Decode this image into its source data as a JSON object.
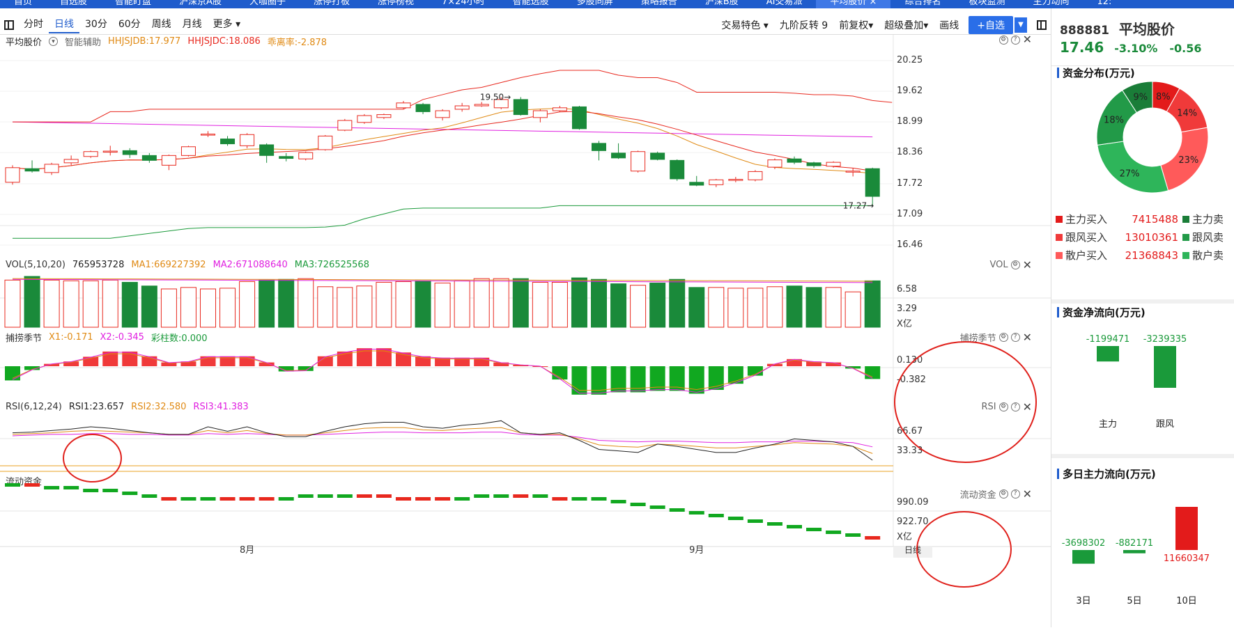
{
  "top_tabs": [
    "首页",
    "自选股",
    "智能盯盘",
    "沪深京A股",
    "大咖圈子",
    "涨停打板",
    "涨停榜视",
    "7×24小时",
    "智能选股",
    "多股同屏",
    "策略报告",
    "沪深B股",
    "AI交易派",
    "平均股价 ×",
    "综合排名",
    "板块监测",
    "主力动向",
    "12:"
  ],
  "toolbar": {
    "periods": [
      "分时",
      "日线",
      "30分",
      "60分",
      "周线",
      "月线",
      "更多 ▾"
    ],
    "active": "日线",
    "right_items": [
      "交易特色 ▾",
      "九阶反转 9",
      "前复权▾",
      "超级叠加▾",
      "画线"
    ],
    "add_btn": "+自选",
    "drop": "▼"
  },
  "main": {
    "name": "平均股价",
    "assist": "智能辅助",
    "hhjsjdb": "HHJSJDB:17.977",
    "hhjsjdc": "HHJSJDC:18.086",
    "bias": "乖离率:-2.878",
    "y_labels": [
      "20.25",
      "19.62",
      "18.99",
      "18.36",
      "17.72",
      "17.09",
      "16.46"
    ],
    "high_label": "19.50→",
    "low_label": "17.27→"
  },
  "vol": {
    "label": "VOL(5,10,20)",
    "value": "765953728",
    "ma1": "MA1:669227392",
    "ma2": "MA2:671088640",
    "ma3": "MA3:726525568",
    "tag": "VOL",
    "y_labels": [
      "6.58",
      "3.29",
      "X亿"
    ]
  },
  "season": {
    "label": "捕捞季节",
    "x1": "X1:-0.171",
    "x2": "X2:-0.345",
    "bar": "彩柱数:0.000",
    "tag": "捕捞季节",
    "y_labels": [
      "0.130",
      "-0.382"
    ]
  },
  "rsi": {
    "label": "RSI(6,12,24)",
    "rsi1": "RSI1:23.657",
    "rsi2": "RSI2:32.580",
    "rsi3": "RSI3:41.383",
    "tag": "RSI",
    "y_labels": [
      "66.67",
      "33.33"
    ]
  },
  "liquid": {
    "label": "流动资金",
    "tag": "流动资金",
    "y_labels": [
      "990.09",
      "922.70",
      "X亿"
    ]
  },
  "xaxis": {
    "labels": [
      "8月",
      "9月"
    ],
    "right": "日线"
  },
  "colors": {
    "up": "#e8281e",
    "down": "#1a8a3a",
    "accent": "#1f5ccc"
  },
  "right_panel": {
    "code": "888881",
    "name": "平均股价",
    "price": "17.46",
    "pct": "-3.10%",
    "chg": "-0.56",
    "dist_title": "资金分布(万元)",
    "donut": [
      {
        "pct": "8%",
        "color": "#e31b1b",
        "value": 8
      },
      {
        "pct": "14%",
        "color": "#f03a3a",
        "value": 14
      },
      {
        "pct": "23%",
        "color": "#ff5a5a",
        "value": 23
      },
      {
        "pct": "27%",
        "color": "#2eb55a",
        "value": 27
      },
      {
        "pct": "18%",
        "color": "#229a48",
        "value": 18
      },
      {
        "pct": "9%",
        "color": "#1a7d38",
        "value": 9
      }
    ],
    "flows": [
      {
        "name": "主力买入",
        "value": "7415488",
        "sell": "主力卖",
        "c1": "#e31b1b",
        "c2": "#1a7d38"
      },
      {
        "name": "跟风买入",
        "value": "13010361",
        "sell": "跟风卖",
        "c1": "#f03a3a",
        "c2": "#229a48"
      },
      {
        "name": "散户买入",
        "value": "21368843",
        "sell": "散户卖",
        "c1": "#ff5a5a",
        "c2": "#2eb55a"
      }
    ],
    "net_title": "资金净流向(万元)",
    "net": [
      {
        "label": "主力",
        "value": "-1199471",
        "amount": -1199471
      },
      {
        "label": "跟风",
        "value": "-3239335",
        "amount": -3239335
      }
    ],
    "multi_title": "多日主力流向(万元)",
    "multi": [
      {
        "label": "3日",
        "value": "-3698302",
        "amount": -3698302
      },
      {
        "label": "5日",
        "value": "-882171",
        "amount": -882171
      },
      {
        "label": "10日",
        "value": "11660347",
        "amount": 11660347
      }
    ]
  },
  "chart_data": {
    "type": "candlestick",
    "candles": [
      {
        "o": 17.75,
        "c": 18.05,
        "h": 18.1,
        "l": 17.7
      },
      {
        "o": 18.03,
        "c": 17.98,
        "h": 18.2,
        "l": 17.95
      },
      {
        "o": 17.95,
        "c": 18.12,
        "h": 18.15,
        "l": 17.9
      },
      {
        "o": 18.15,
        "c": 18.22,
        "h": 18.3,
        "l": 18.1
      },
      {
        "o": 18.28,
        "c": 18.38,
        "h": 18.4,
        "l": 18.25
      },
      {
        "o": 18.38,
        "c": 18.39,
        "h": 18.5,
        "l": 18.3
      },
      {
        "o": 18.4,
        "c": 18.32,
        "h": 18.45,
        "l": 18.25
      },
      {
        "o": 18.3,
        "c": 18.2,
        "h": 18.35,
        "l": 18.15
      },
      {
        "o": 18.1,
        "c": 18.3,
        "h": 18.32,
        "l": 18.0
      },
      {
        "o": 18.3,
        "c": 18.48,
        "h": 18.5,
        "l": 18.28
      },
      {
        "o": 18.72,
        "c": 18.74,
        "h": 18.8,
        "l": 18.68
      },
      {
        "o": 18.64,
        "c": 18.54,
        "h": 18.7,
        "l": 18.5
      },
      {
        "o": 18.5,
        "c": 18.73,
        "h": 18.76,
        "l": 18.45
      },
      {
        "o": 18.52,
        "c": 18.3,
        "h": 18.55,
        "l": 18.15
      },
      {
        "o": 18.28,
        "c": 18.24,
        "h": 18.35,
        "l": 18.18
      },
      {
        "o": 18.23,
        "c": 18.36,
        "h": 18.38,
        "l": 18.2
      },
      {
        "o": 18.42,
        "c": 18.7,
        "h": 18.72,
        "l": 18.4
      },
      {
        "o": 18.82,
        "c": 19.02,
        "h": 19.05,
        "l": 18.8
      },
      {
        "o": 18.98,
        "c": 19.12,
        "h": 19.15,
        "l": 18.95
      },
      {
        "o": 19.08,
        "c": 19.14,
        "h": 19.16,
        "l": 19.05
      },
      {
        "o": 19.28,
        "c": 19.38,
        "h": 19.42,
        "l": 19.25
      },
      {
        "o": 19.35,
        "c": 19.2,
        "h": 19.38,
        "l": 19.15
      },
      {
        "o": 19.08,
        "c": 19.22,
        "h": 19.25,
        "l": 19.02
      },
      {
        "o": 19.25,
        "c": 19.32,
        "h": 19.38,
        "l": 19.2
      },
      {
        "o": 19.32,
        "c": 19.35,
        "h": 19.4,
        "l": 19.3
      },
      {
        "o": 19.28,
        "c": 19.45,
        "h": 19.5,
        "l": 19.25
      },
      {
        "o": 19.45,
        "c": 19.14,
        "h": 19.5,
        "l": 19.12
      },
      {
        "o": 19.08,
        "c": 19.22,
        "h": 19.25,
        "l": 18.98
      },
      {
        "o": 19.22,
        "c": 19.28,
        "h": 19.32,
        "l": 19.2
      },
      {
        "o": 19.3,
        "c": 18.85,
        "h": 19.32,
        "l": 18.83
      },
      {
        "o": 18.55,
        "c": 18.4,
        "h": 18.6,
        "l": 18.2
      },
      {
        "o": 18.35,
        "c": 18.25,
        "h": 18.55,
        "l": 18.23
      },
      {
        "o": 17.98,
        "c": 18.38,
        "h": 18.4,
        "l": 17.95
      },
      {
        "o": 18.35,
        "c": 18.22,
        "h": 18.38,
        "l": 18.2
      },
      {
        "o": 18.2,
        "c": 17.82,
        "h": 18.22,
        "l": 17.78
      },
      {
        "o": 17.75,
        "c": 17.69,
        "h": 17.88,
        "l": 17.67
      },
      {
        "o": 17.7,
        "c": 17.8,
        "h": 17.82,
        "l": 17.65
      },
      {
        "o": 17.8,
        "c": 17.81,
        "h": 17.86,
        "l": 17.75
      },
      {
        "o": 17.8,
        "c": 17.97,
        "h": 18.0,
        "l": 17.77
      },
      {
        "o": 18.06,
        "c": 18.21,
        "h": 18.24,
        "l": 18.02
      },
      {
        "o": 18.23,
        "c": 18.16,
        "h": 18.28,
        "l": 18.12
      },
      {
        "o": 18.15,
        "c": 18.09,
        "h": 18.17,
        "l": 18.05
      },
      {
        "o": 18.08,
        "c": 18.16,
        "h": 18.18,
        "l": 18.05
      },
      {
        "o": 17.97,
        "c": 17.98,
        "h": 18.04,
        "l": 17.87
      },
      {
        "o": 18.03,
        "c": 17.46,
        "h": 18.05,
        "l": 17.27
      }
    ],
    "upper": [
      18.99,
      18.99,
      18.99,
      18.99,
      18.99,
      19.2,
      19.2,
      19.25,
      19.25,
      19.25,
      19.25,
      19.25,
      19.25,
      19.25,
      19.25,
      19.25,
      19.25,
      19.25,
      19.25,
      19.25,
      19.25,
      19.45,
      19.55,
      19.65,
      19.7,
      19.8,
      19.9,
      19.98,
      20.05,
      20.05,
      20.05,
      19.95,
      19.9,
      19.9,
      19.8,
      19.6,
      19.6,
      19.6,
      19.6,
      19.6,
      19.58,
      19.55,
      19.55,
      19.52,
      19.43,
      19.39
    ],
    "lower": [
      16.6,
      16.6,
      16.6,
      16.6,
      16.6,
      16.6,
      16.65,
      16.7,
      16.75,
      16.8,
      16.82,
      16.82,
      16.82,
      16.82,
      16.82,
      16.82,
      16.83,
      16.87,
      17.0,
      17.1,
      17.2,
      17.22,
      17.22,
      17.22,
      17.22,
      17.22,
      17.22,
      17.22,
      17.27,
      17.27,
      17.27,
      17.27,
      17.27,
      17.27,
      17.27,
      17.27,
      17.27,
      17.27,
      17.27,
      17.27,
      17.27,
      17.27,
      17.27,
      17.27,
      17.27
    ],
    "vol_up": [
      true,
      false,
      true,
      true,
      true,
      true,
      false,
      false,
      true,
      true,
      true,
      true,
      true,
      false,
      false,
      true,
      true,
      true,
      true,
      true,
      true,
      false,
      true,
      true,
      true,
      true,
      false,
      true,
      true,
      false,
      false,
      false,
      true,
      false,
      false,
      false,
      true,
      true,
      true,
      true,
      false,
      false,
      true,
      true,
      false
    ],
    "vol": [
      6.4,
      6.9,
      6.4,
      6.3,
      6.3,
      6.4,
      6.1,
      5.6,
      5.2,
      5.4,
      5.2,
      5.3,
      6.2,
      6.4,
      6.5,
      6.6,
      5.5,
      5.4,
      5.6,
      6.1,
      6.2,
      6.3,
      6.0,
      6.3,
      6.6,
      6.6,
      6.6,
      6.1,
      6.1,
      6.7,
      6.5,
      5.9,
      5.7,
      6.0,
      6.5,
      5.4,
      5.4,
      5.3,
      5.3,
      5.5,
      5.6,
      5.4,
      5.4,
      4.8,
      6.3
    ],
    "season_vals": [
      -0.3,
      -0.08,
      0.05,
      0.1,
      0.2,
      0.31,
      0.31,
      0.21,
      0.08,
      0.1,
      0.21,
      0.21,
      0.21,
      0.08,
      -0.11,
      -0.1,
      0.21,
      0.31,
      0.38,
      0.38,
      0.29,
      0.21,
      0.18,
      0.18,
      0.18,
      0.08,
      0.03,
      0.0,
      -0.28,
      -0.6,
      -0.6,
      -0.55,
      -0.55,
      -0.52,
      -0.52,
      -0.58,
      -0.5,
      -0.37,
      -0.2,
      0.05,
      0.15,
      0.1,
      0.08,
      -0.05,
      -0.27
    ],
    "rsi1": [
      60,
      61,
      63,
      65,
      68,
      66,
      63,
      60,
      58,
      58,
      68,
      62,
      68,
      60,
      55,
      55,
      62,
      68,
      72,
      74,
      74,
      68,
      66,
      70,
      72,
      76,
      60,
      58,
      60,
      50,
      38,
      36,
      34,
      45,
      42,
      38,
      34,
      34,
      40,
      45,
      52,
      50,
      48,
      42,
      23.7
    ],
    "rsi2": [
      58,
      59,
      60,
      62,
      63,
      62,
      61,
      60,
      58,
      58,
      63,
      60,
      63,
      59,
      57,
      57,
      60,
      63,
      66,
      67,
      67,
      64,
      63,
      65,
      66,
      67,
      60,
      58,
      58,
      52,
      44,
      42,
      41,
      45,
      44,
      42,
      40,
      40,
      42,
      44,
      47,
      46,
      45,
      42,
      32.6
    ],
    "rsi3": [
      56,
      57,
      58,
      58,
      59,
      59,
      58,
      58,
      57,
      57,
      59,
      58,
      59,
      58,
      57,
      57,
      58,
      59,
      60,
      61,
      61,
      60,
      60,
      60,
      61,
      61,
      58,
      57,
      57,
      54,
      50,
      49,
      48,
      49,
      49,
      48,
      47,
      47,
      48,
      48,
      49,
      49,
      48,
      47,
      41.4
    ],
    "liquid": [
      0,
      0,
      -1,
      -1,
      -2,
      -2,
      -3,
      -4,
      -5,
      -5,
      -5,
      -5,
      -5,
      -5,
      -5,
      -4,
      -4,
      -4,
      -4,
      -4,
      -5,
      -5,
      -5,
      -5,
      -4,
      -4,
      -4,
      -4,
      -5,
      -5,
      -5,
      -6,
      -7,
      -8,
      -9,
      -10,
      -11,
      -12,
      -13,
      -14,
      -15,
      -16,
      -17,
      -18,
      -19
    ],
    "liquid_up": [
      false,
      true,
      false,
      false,
      false,
      false,
      false,
      false,
      true,
      false,
      false,
      true,
      true,
      true,
      false,
      false,
      false,
      false,
      true,
      true,
      true,
      true,
      true,
      false,
      false,
      false,
      true,
      false,
      true,
      false,
      false,
      false,
      false,
      false,
      false,
      false,
      false,
      false,
      false,
      false,
      false,
      false,
      false,
      false,
      true
    ]
  }
}
